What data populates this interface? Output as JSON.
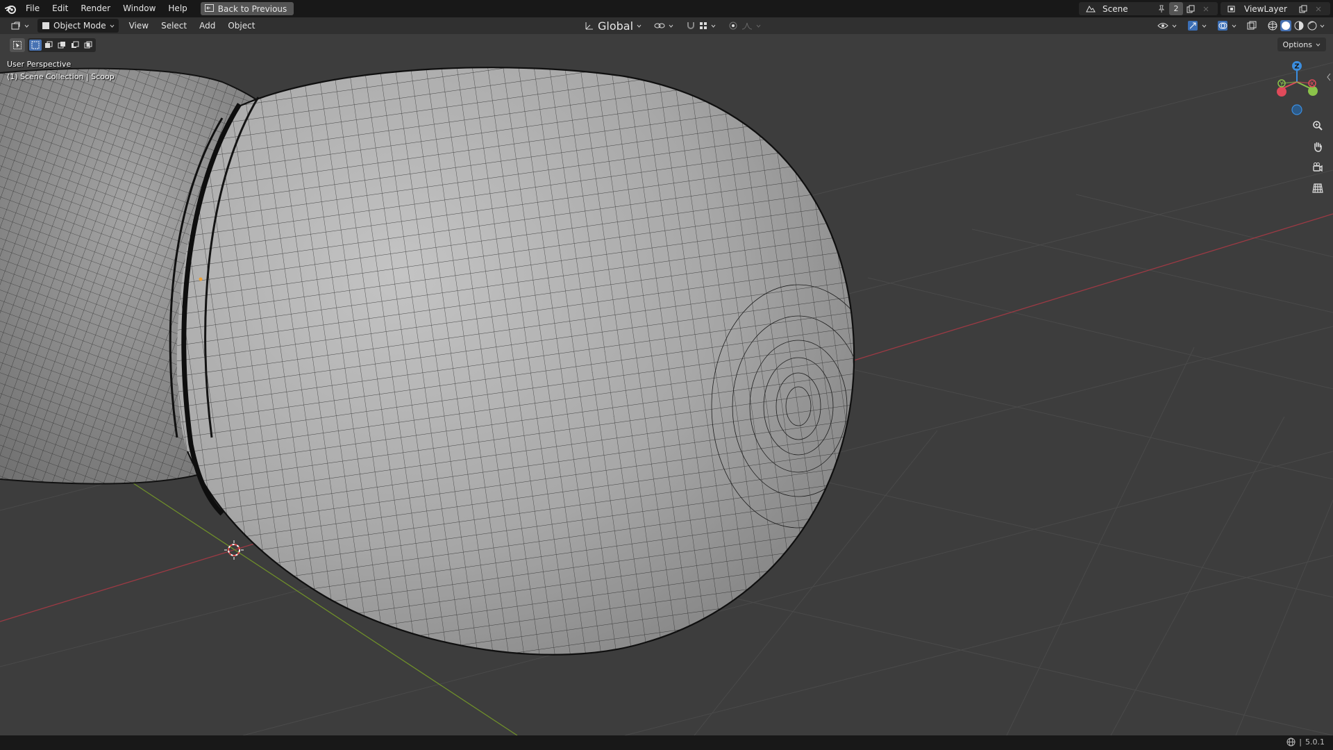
{
  "topbar": {
    "menus": [
      "File",
      "Edit",
      "Render",
      "Window",
      "Help"
    ],
    "back_label": "Back to Previous",
    "scene_name": "Scene",
    "scene_users": "2",
    "view_layer": "ViewLayer"
  },
  "header": {
    "mode": "Object Mode",
    "menus": [
      "View",
      "Select",
      "Add",
      "Object"
    ],
    "transform_orientation": "Global"
  },
  "viewport": {
    "perspective_label": "User Perspective",
    "collection_label": "(1) Scene Collection | Scoop",
    "options_label": "Options",
    "grid_color": "#4a4a4a",
    "x_axis_color": "#9c3a44",
    "y_axis_color": "#6f8f2a",
    "mesh_color": "#a8a8a8",
    "wire_color": "#1a1a1a"
  },
  "gizmo": {
    "z_label": "Z",
    "y_label": "Y",
    "x_label": "X",
    "x_color": "#e04a5a",
    "y_color": "#8bc34a",
    "z_color": "#3b8ee0"
  },
  "status": {
    "version": "5.0.1"
  }
}
